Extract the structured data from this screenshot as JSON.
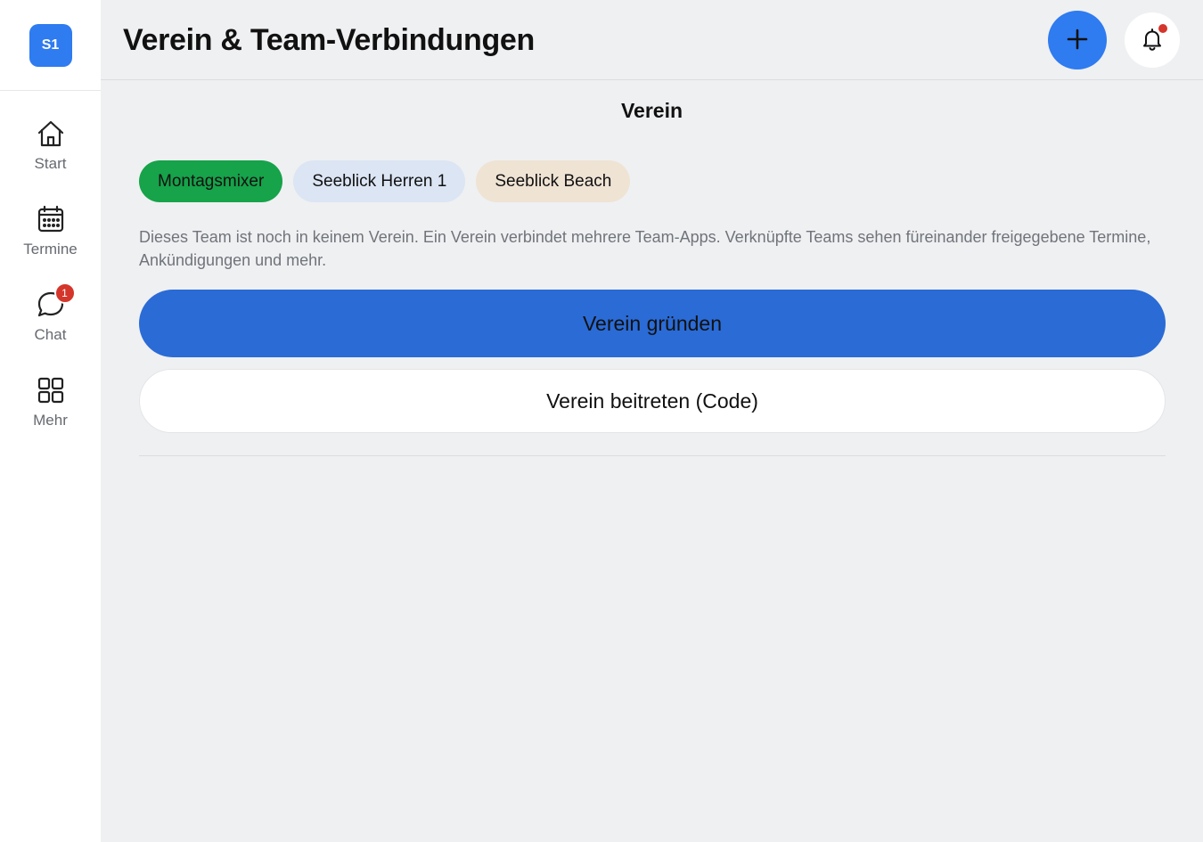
{
  "team": {
    "avatar_initials": "S1"
  },
  "sidebar": {
    "items": [
      {
        "label": "Start",
        "icon": "home-icon"
      },
      {
        "label": "Termine",
        "icon": "calendar-icon"
      },
      {
        "label": "Chat",
        "icon": "chat-icon",
        "badge": "1"
      },
      {
        "label": "Mehr",
        "icon": "grid-icon"
      }
    ]
  },
  "header": {
    "title": "Verein & Team-Verbindungen",
    "add_icon": "plus-icon",
    "notifications_icon": "bell-icon"
  },
  "main": {
    "section_title": "Verein",
    "chips": [
      {
        "label": "Montagsmixer",
        "color": "#16a34a"
      },
      {
        "label": "Seeblick Herren 1",
        "color": "#dbe5f4"
      },
      {
        "label": "Seeblick Beach",
        "color": "#efe3d4"
      }
    ],
    "description": "Dieses Team ist noch in keinem Verein. Ein Verein verbindet mehrere Team-Apps. Verknüpfte Teams sehen füreinander freigegebene Termine, Ankündigungen und mehr.",
    "primary_button": "Verein gründen",
    "secondary_button": "Verein beitreten (Code)"
  },
  "colors": {
    "accent": "#2f7bf0",
    "primary_button": "#2a6bd6",
    "badge": "#d4362b",
    "background": "#eff0f2"
  }
}
